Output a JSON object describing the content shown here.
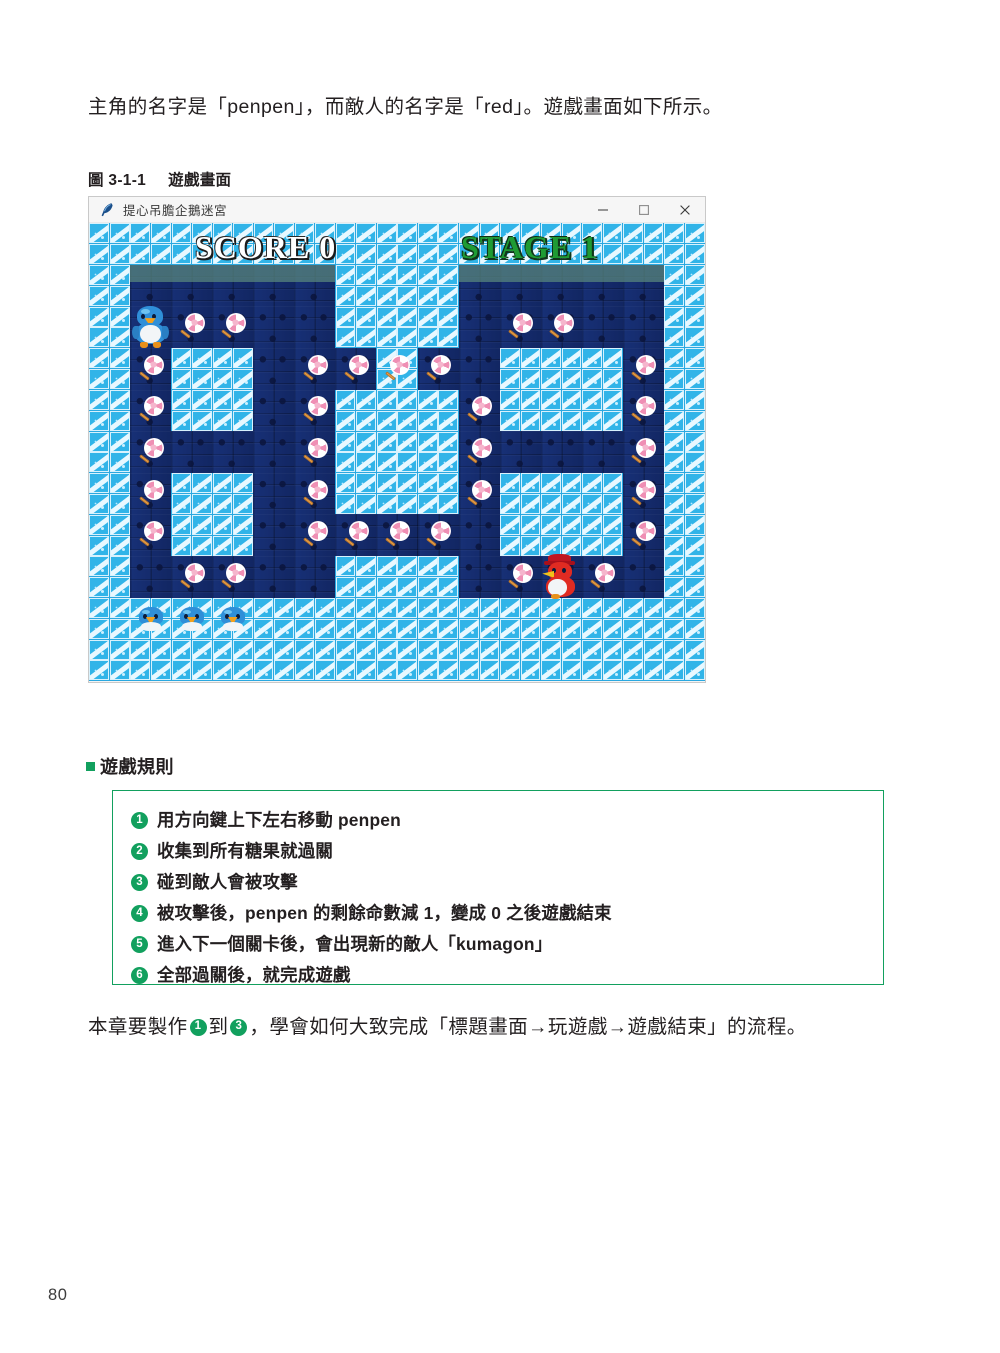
{
  "document": {
    "intro_paragraph": "主角的名字是「penpen」，而敵人的名字是「red」。遊戲畫面如下所示。",
    "figure_number": "圖 3-1-1",
    "figure_title": "遊戲畫面",
    "closing_prefix": "本章要製作",
    "closing_mid": "到",
    "closing_suffix": "，學會如何大致完成「標題畫面→玩遊戲→遊戲結束」的流程。",
    "closing_badge_1": "1",
    "closing_badge_2": "3",
    "page_number": "80"
  },
  "app_window": {
    "title": "提心吊膽企鵝迷宮",
    "icon": "feather-icon",
    "controls": {
      "minimize": "minimize-icon",
      "maximize": "maximize-icon",
      "close": "close-icon"
    }
  },
  "game": {
    "hud": {
      "score_label": "SCORE 0",
      "score_color": "#ffffff",
      "stage_label": "STAGE 1",
      "stage_color": "#1f9b33"
    },
    "lives_count": 3,
    "hero_sprite": "penpen-penguin",
    "enemy_sprite": "red-enemy-penguin",
    "item_sprite": "lollipop-candy",
    "candy_total": 30,
    "grid": {
      "cols": 15,
      "rows": 11,
      "legend": {
        "1": "ice-wall",
        "0": "floor",
        "2": "floor-moss",
        "3": "floor-lit"
      },
      "map": [
        [
          1,
          1,
          1,
          1,
          1,
          1,
          1,
          1,
          1,
          1,
          1,
          1,
          1,
          1,
          1
        ],
        [
          1,
          2,
          2,
          2,
          2,
          2,
          1,
          1,
          1,
          2,
          2,
          2,
          2,
          2,
          1
        ],
        [
          1,
          0,
          0,
          0,
          0,
          0,
          1,
          1,
          1,
          0,
          0,
          0,
          0,
          0,
          1
        ],
        [
          1,
          0,
          1,
          1,
          0,
          0,
          0,
          1,
          0,
          0,
          1,
          1,
          1,
          0,
          1
        ],
        [
          1,
          0,
          1,
          1,
          0,
          0,
          1,
          1,
          1,
          0,
          1,
          1,
          1,
          0,
          1
        ],
        [
          1,
          0,
          0,
          0,
          0,
          0,
          1,
          1,
          1,
          0,
          0,
          0,
          0,
          0,
          1
        ],
        [
          1,
          0,
          1,
          1,
          0,
          0,
          1,
          1,
          1,
          0,
          1,
          1,
          1,
          0,
          1
        ],
        [
          1,
          0,
          1,
          1,
          0,
          0,
          0,
          0,
          0,
          0,
          1,
          1,
          1,
          0,
          1
        ],
        [
          1,
          0,
          0,
          0,
          0,
          0,
          1,
          1,
          1,
          0,
          0,
          0,
          0,
          0,
          1
        ],
        [
          1,
          1,
          1,
          1,
          1,
          1,
          1,
          1,
          1,
          1,
          1,
          1,
          1,
          1,
          1
        ],
        [
          1,
          1,
          1,
          1,
          1,
          1,
          1,
          1,
          1,
          1,
          1,
          1,
          1,
          1,
          1
        ]
      ]
    },
    "hero_position": {
      "col": 1,
      "row": 2
    },
    "enemy_position": {
      "col": 11,
      "row": 8
    },
    "lives_positions": [
      {
        "col": 1,
        "row": 9
      },
      {
        "col": 2,
        "row": 9
      },
      {
        "col": 3,
        "row": 9
      }
    ],
    "candies": [
      {
        "col": 2,
        "row": 2
      },
      {
        "col": 3,
        "row": 2
      },
      {
        "col": 10,
        "row": 2
      },
      {
        "col": 11,
        "row": 2
      },
      {
        "col": 1,
        "row": 3
      },
      {
        "col": 5,
        "row": 3
      },
      {
        "col": 6,
        "row": 3
      },
      {
        "col": 7,
        "row": 3
      },
      {
        "col": 8,
        "row": 3
      },
      {
        "col": 13,
        "row": 3
      },
      {
        "col": 1,
        "row": 4
      },
      {
        "col": 5,
        "row": 4
      },
      {
        "col": 9,
        "row": 4
      },
      {
        "col": 13,
        "row": 4
      },
      {
        "col": 1,
        "row": 5
      },
      {
        "col": 5,
        "row": 5
      },
      {
        "col": 9,
        "row": 5
      },
      {
        "col": 13,
        "row": 5
      },
      {
        "col": 1,
        "row": 6
      },
      {
        "col": 5,
        "row": 6
      },
      {
        "col": 9,
        "row": 6
      },
      {
        "col": 13,
        "row": 6
      },
      {
        "col": 1,
        "row": 7
      },
      {
        "col": 5,
        "row": 7
      },
      {
        "col": 6,
        "row": 7
      },
      {
        "col": 7,
        "row": 7
      },
      {
        "col": 8,
        "row": 7
      },
      {
        "col": 13,
        "row": 7
      },
      {
        "col": 2,
        "row": 8
      },
      {
        "col": 3,
        "row": 8
      },
      {
        "col": 10,
        "row": 8
      },
      {
        "col": 12,
        "row": 8
      }
    ]
  },
  "rules_section": {
    "heading": "遊戲規則",
    "accent_color": "#12a05e",
    "items": [
      {
        "number": "1",
        "text": "用方向鍵上下左右移動 penpen"
      },
      {
        "number": "2",
        "text": "收集到所有糖果就過關"
      },
      {
        "number": "3",
        "text": "碰到敵人會被攻擊"
      },
      {
        "number": "4",
        "text": "被攻擊後，penpen 的剩餘命數減 1，變成 0 之後遊戲結束"
      },
      {
        "number": "5",
        "text": "進入下一個關卡後，會出現新的敵人「kumagon」"
      },
      {
        "number": "6",
        "text": "全部過關後，就完成遊戲"
      }
    ]
  }
}
